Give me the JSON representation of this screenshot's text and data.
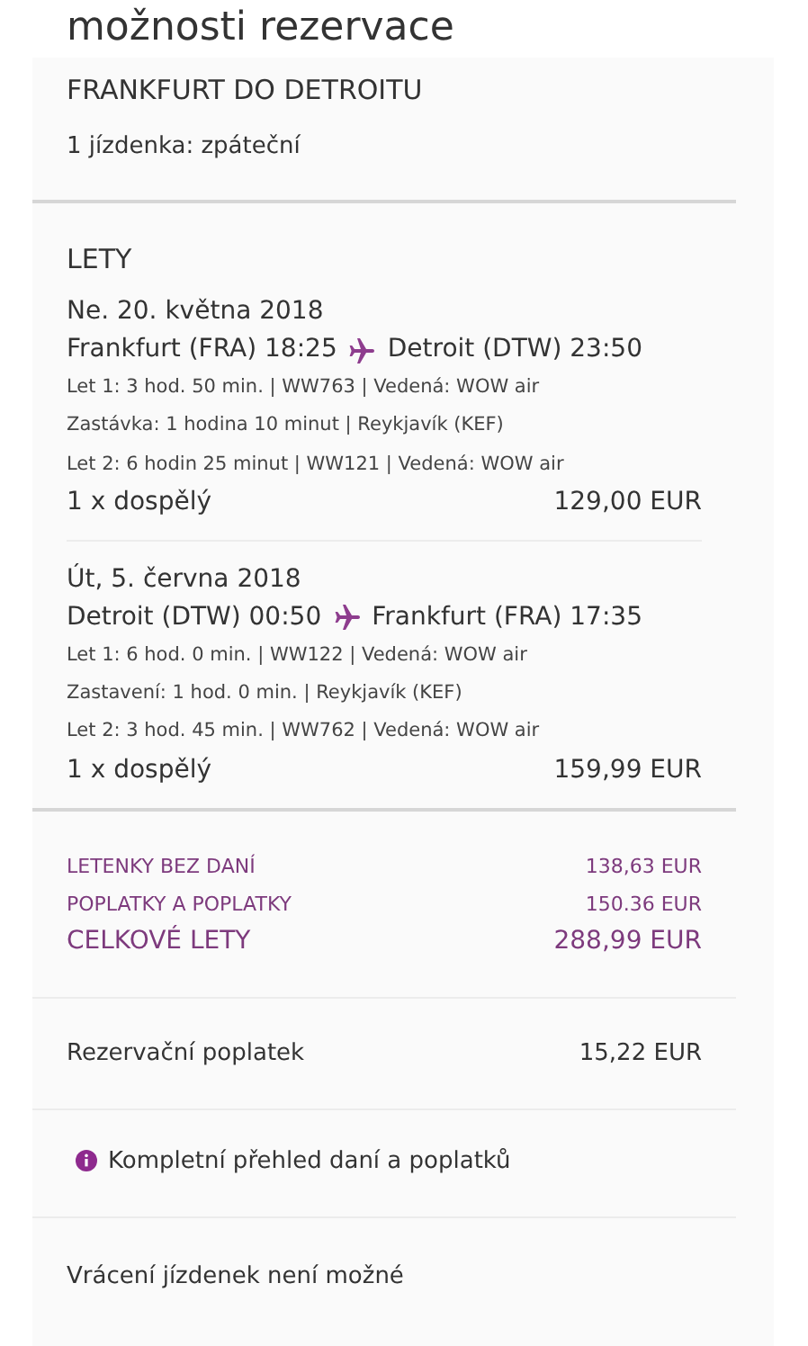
{
  "title": "možnosti rezervace",
  "route_title": "FRANKFURT DO DETROITU",
  "ticket_info": "1 jízdenka: zpáteční",
  "flights_heading": "LETY",
  "flights": [
    {
      "date": "Ne. 20. května 2018",
      "from": "Frankfurt (FRA) 18:25",
      "to": "Detroit (DTW) 23:50",
      "details": [
        "Let 1: 3 hod. 50 min. | WW763 | Vedená: WOW air",
        "Zastávka: 1 hodina 10 minut | Reykjavík (KEF)",
        "Let 2: 6 hodin 25 minut | WW121 | Vedená: WOW air"
      ],
      "passenger": "1 x dospělý",
      "price": "129,00 EUR"
    },
    {
      "date": "Út, 5. června 2018",
      "from": "Detroit (DTW) 00:50",
      "to": "Frankfurt (FRA) 17:35",
      "details": [
        "Let 1: 6 hod. 0 min. | WW122 | Vedená: WOW air",
        "Zastavení: 1 hod. 0 min. | Reykjavík (KEF)",
        "Let 2: 3 hod. 45 min. | WW762 | Vedená: WOW air"
      ],
      "passenger": "1 x dospělý",
      "price": "159,99 EUR"
    }
  ],
  "totals": [
    {
      "kind": "sub",
      "label": "LETENKY BEZ DANÍ",
      "value": "138,63 EUR"
    },
    {
      "kind": "sub",
      "label": "POPLATKY A POPLATKY",
      "value": "150.36 EUR"
    },
    {
      "kind": "total",
      "label": "CELKOVÉ LETY",
      "value": "288,99 EUR"
    }
  ],
  "booking_fee": {
    "label": "Rezervační poplatek",
    "value": "15,22 EUR"
  },
  "tax_link": "Kompletní přehled daní a poplatků",
  "refund_note": "Vrácení jízdenek není možné"
}
